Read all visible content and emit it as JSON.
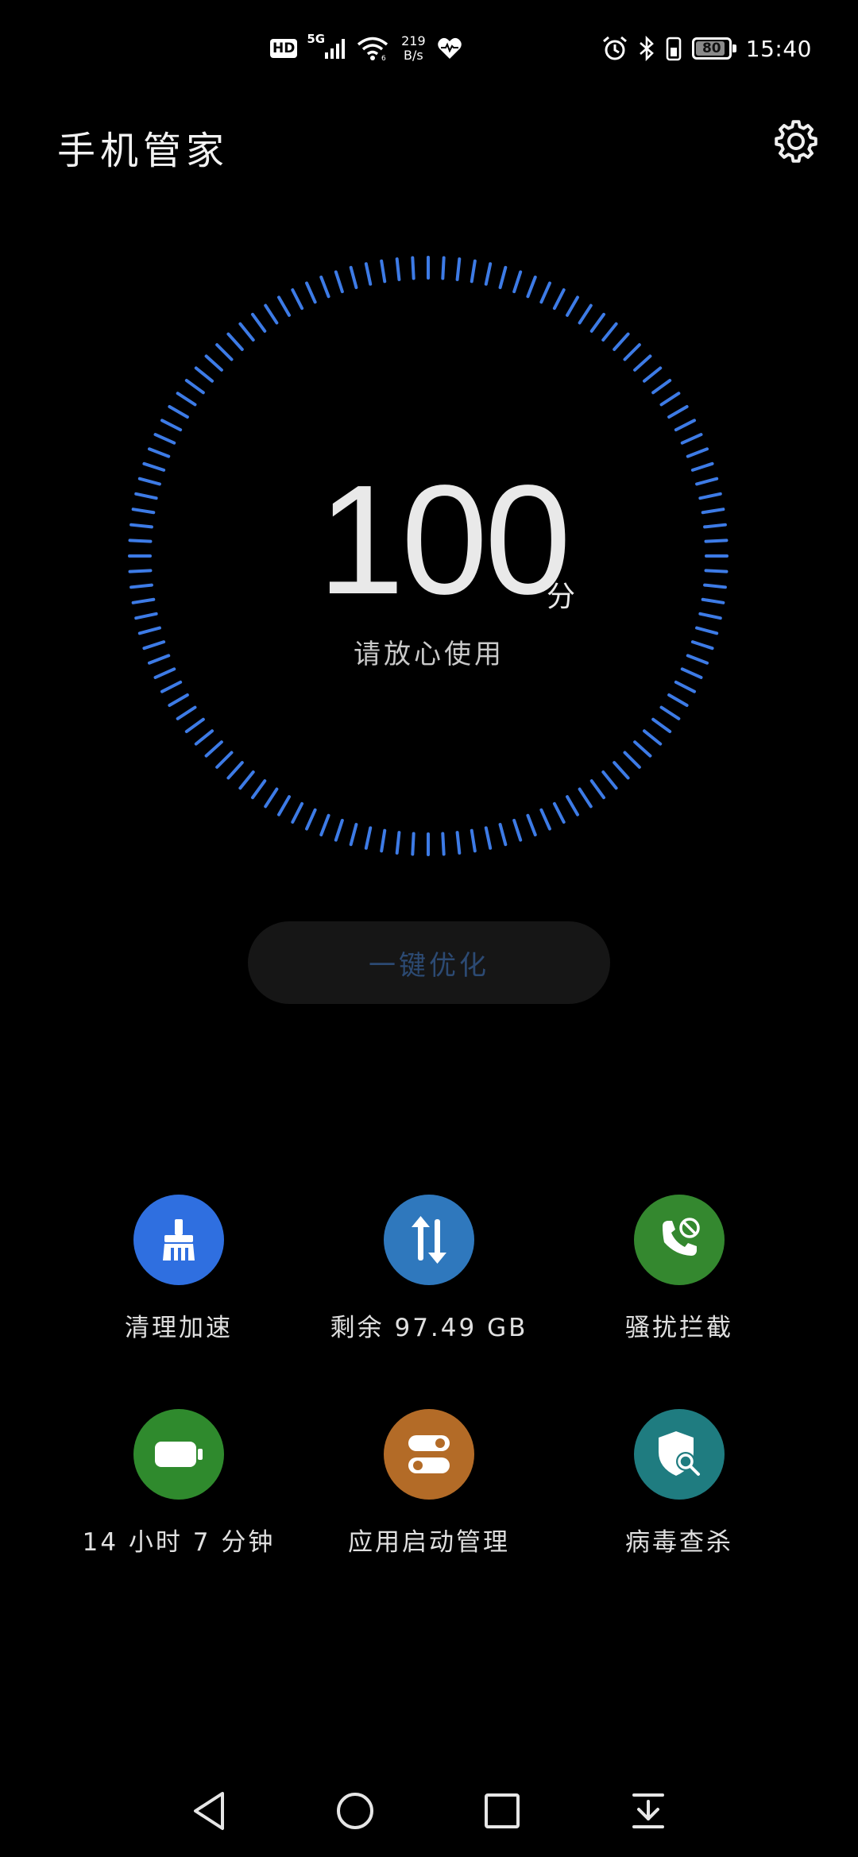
{
  "status_bar": {
    "hd_label": "HD",
    "network_label": "5G",
    "speed_value": "219",
    "speed_unit": "B/s",
    "battery_level": "80",
    "battery_percent": 80,
    "time": "15:40"
  },
  "header": {
    "title": "手机管家"
  },
  "score": {
    "value": "100",
    "unit": "分",
    "status": "请放心使用",
    "ring_color": "#3d7be6"
  },
  "optimize_button": {
    "label": "一键优化"
  },
  "features": [
    {
      "label": "清理加速",
      "icon": "broom-icon",
      "color": "#2f6fe0"
    },
    {
      "label": "剩余 97.49 GB",
      "icon": "transfer-arrows-icon",
      "color": "#2f78bd"
    },
    {
      "label": "骚扰拦截",
      "icon": "phone-block-icon",
      "color": "#34882f"
    },
    {
      "label": "14 小时 7 分钟",
      "icon": "battery-icon",
      "color": "#2f8a2d"
    },
    {
      "label": "应用启动管理",
      "icon": "toggle-switch-icon",
      "color": "#b36b27"
    },
    {
      "label": "病毒查杀",
      "icon": "shield-search-icon",
      "color": "#1f7c80"
    }
  ],
  "navigation": {
    "back_icon": "back-triangle-icon",
    "home_icon": "home-circle-icon",
    "recents_icon": "recents-square-icon",
    "notifications_icon": "pull-down-icon"
  }
}
